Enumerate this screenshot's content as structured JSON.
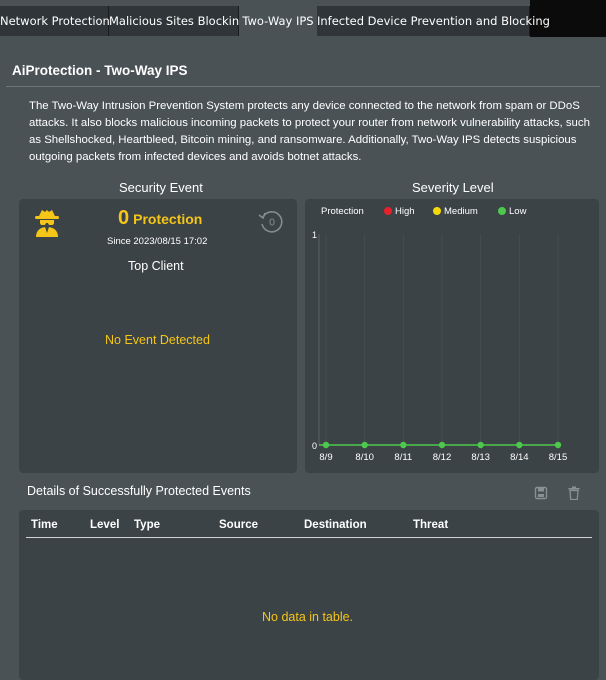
{
  "tabs": [
    {
      "label": "Network Protection"
    },
    {
      "label": "Malicious Sites Blocking"
    },
    {
      "label": "Two-Way IPS"
    },
    {
      "label": "Infected Device Prevention and Blocking"
    }
  ],
  "page": {
    "title": "AiProtection - Two-Way IPS",
    "description": "The Two-Way Intrusion Prevention System protects any device connected to the network from spam or DDoS attacks. It also blocks malicious incoming packets to protect your router from network vulnerability attacks, such as Shellshocked, Heartbleed, Bitcoin mining, and ransomware. Additionally, Two-Way IPS detects suspicious outgoing packets from infected devices and avoids botnet attacks."
  },
  "security_event": {
    "heading": "Security Event",
    "count": "0",
    "count_label": "Protection",
    "since": "Since 2023/08/15 17:02",
    "reset_icon_text": "0",
    "top_client_heading": "Top Client",
    "empty_message": "No Event Detected"
  },
  "severity": {
    "heading": "Severity Level",
    "legend_title": "Protection",
    "legend": [
      {
        "label": "High",
        "color": "#e8202a"
      },
      {
        "label": "Medium",
        "color": "#f5d90a"
      },
      {
        "label": "Low",
        "color": "#4cc94c"
      }
    ]
  },
  "chart_data": {
    "type": "line",
    "categories": [
      "8/9",
      "8/10",
      "8/11",
      "8/12",
      "8/13",
      "8/14",
      "8/15"
    ],
    "ylim": [
      0,
      1
    ],
    "yticks": [
      "0",
      "1"
    ],
    "series": [
      {
        "name": "Low",
        "color": "#4cc94c",
        "values": [
          0,
          0,
          0,
          0,
          0,
          0,
          0
        ]
      }
    ]
  },
  "details": {
    "heading": "Details of Successfully Protected Events",
    "columns": [
      "Time",
      "Level",
      "Type",
      "Source",
      "Destination",
      "Threat"
    ],
    "empty_message": "No data in table.",
    "icons": [
      "save-icon",
      "trash-icon"
    ]
  }
}
